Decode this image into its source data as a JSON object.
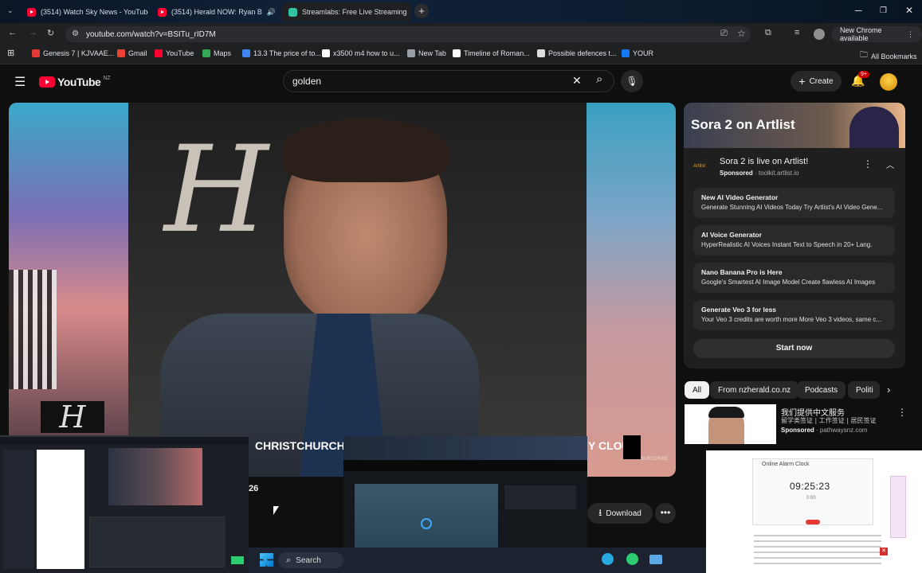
{
  "browser": {
    "tabs": [
      {
        "title": "(3514) Watch Sky News - YouTube",
        "active": false
      },
      {
        "title": "(3514) Herald NOW: Ryan B",
        "active": false
      },
      {
        "title": "Streamlabs: Free Live Streaming",
        "active": true
      }
    ],
    "url": "youtube.com/watch?v=BSITu_rID7M",
    "new_chrome_label": "New Chrome available",
    "bookmarks": [
      {
        "label": "Genesis 7 | KJVAAE...",
        "icon": "bookmark-icon",
        "color": "#e53935"
      },
      {
        "label": "Gmail",
        "icon": "gmail-icon",
        "color": "#ea4335"
      },
      {
        "label": "YouTube",
        "icon": "youtube-icon",
        "color": "#ff0033"
      },
      {
        "label": "Maps",
        "icon": "maps-icon",
        "color": "#34a853"
      },
      {
        "label": "13.3 The price of to...",
        "icon": "doc-icon",
        "color": "#4285f4"
      },
      {
        "label": "x3500 m4 how to u...",
        "icon": "google-icon",
        "color": "#ffffff"
      },
      {
        "label": "New Tab",
        "icon": "globe-icon",
        "color": "#9aa0a6"
      },
      {
        "label": "Timeline of Roman...",
        "icon": "wikipedia-icon",
        "color": "#ffffff"
      },
      {
        "label": "Possible defences t...",
        "icon": "cl-icon",
        "color": "#dddddd"
      },
      {
        "label": "YOUR",
        "icon": "facebook-icon",
        "color": "#1877f2"
      }
    ],
    "all_bookmarks_label": "All Bookmarks"
  },
  "youtube": {
    "region": "NZ",
    "logo_text": "YouTube",
    "search_value": "golden",
    "create_label": "Create",
    "notif_badge": "9+",
    "video_overlay": {
      "lower_third": "CHRISTCHURCH",
      "lower_third_right": "Y CLOU",
      "subscribe": "SUBSCRIBE",
      "partial_number": "26"
    },
    "download_label": "Download"
  },
  "ad": {
    "banner_title": "Sora 2 on Artlist",
    "brand": "Artlist",
    "title": "Sora 2 is live on Artlist!",
    "sponsored": "Sponsored",
    "domain": "toolkit.artlist.io",
    "rows": [
      {
        "title": "New AI Video Generator",
        "desc": "Generate Stunning AI Videos Today Try Artlist's AI Video Gene..."
      },
      {
        "title": "AI Voice Generator",
        "desc": "HyperRealistic AI Voices Instant Text to Speech in 20+ Lang."
      },
      {
        "title": "Nano Banana Pro is Here",
        "desc": "Google's Smartest AI Image Model Create flawless AI Images"
      },
      {
        "title": "Generate Veo 3 for less",
        "desc": "Your Veo 3 credits are worth more More Veo 3 videos, same c..."
      }
    ],
    "cta": "Start now"
  },
  "chips": [
    "All",
    "From nzherald.co.nz",
    "Podcasts",
    "Politi"
  ],
  "second_ad": {
    "title": "我们提供中文服务",
    "desc": "留学类签证 | 工作签证 | 居民签证",
    "sponsored": "Sponsored",
    "domain": "pathwaysnz.com"
  },
  "taskbar": {
    "search_label": "Search"
  },
  "overlay_app": {
    "title": "Online Alarm Clock",
    "time": "09:25:23",
    "sub": "0:00",
    "url": "www.nzherald.co.nz"
  },
  "colors": {
    "accent": "#ff0033",
    "chip_selected": "#f1f1f1",
    "cta": "#3ea6ff"
  }
}
